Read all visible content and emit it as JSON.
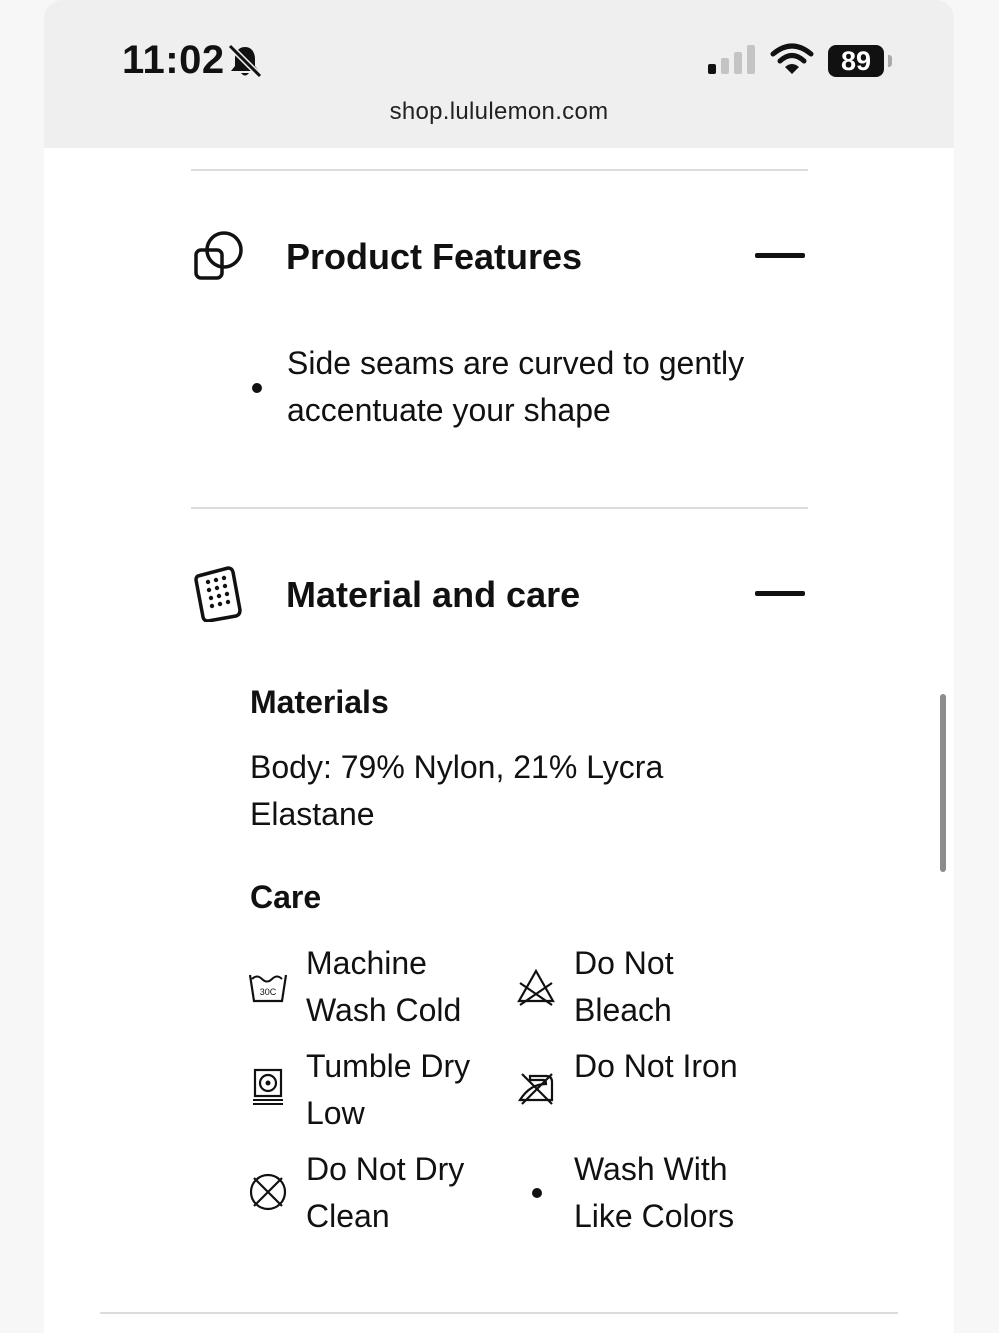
{
  "status_bar": {
    "time": "11:02",
    "battery": "89",
    "url": "shop.lululemon.com"
  },
  "product_features": {
    "title": "Product Features",
    "bullets": [
      "Side seams are curved to gently accentuate your shape"
    ]
  },
  "material_care": {
    "title": "Material and care",
    "materials_heading": "Materials",
    "materials_text": "Body: 79% Nylon, 21% Lycra Elastane",
    "care_heading": "Care",
    "care_items": [
      {
        "label": "Machine Wash Cold",
        "icon": "machine-wash-30c-icon"
      },
      {
        "label": "Do Not Bleach",
        "icon": "do-not-bleach-icon"
      },
      {
        "label": "Tumble Dry Low",
        "icon": "tumble-dry-low-icon"
      },
      {
        "label": "Do Not Iron",
        "icon": "do-not-iron-icon"
      },
      {
        "label": "Do Not Dry Clean",
        "icon": "do-not-dry-clean-icon"
      },
      {
        "label": "Wash With Like Colors",
        "icon": "bullet"
      }
    ],
    "wash_icon_text": "30C"
  }
}
